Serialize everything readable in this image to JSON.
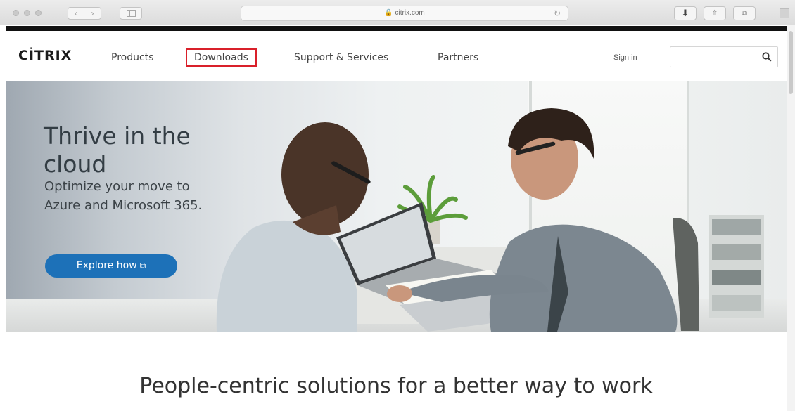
{
  "browser": {
    "url": "citrix.com",
    "lock_icon": "lock-icon"
  },
  "header": {
    "logo": "CİTRIX",
    "nav": [
      "Products",
      "Downloads",
      "Support & Services",
      "Partners"
    ],
    "sign_in": "Sign in",
    "search_placeholder": "",
    "highlight_color": "#d9202a"
  },
  "hero": {
    "title": "Thrive in the cloud",
    "subtitle": "Optimize your move to Azure and Microsoft 365.",
    "cta": "Explore how",
    "cta_icon": "external-link-icon",
    "cta_color": "#1d71b8"
  },
  "main": {
    "tagline": "People-centric solutions for a better way to work"
  }
}
